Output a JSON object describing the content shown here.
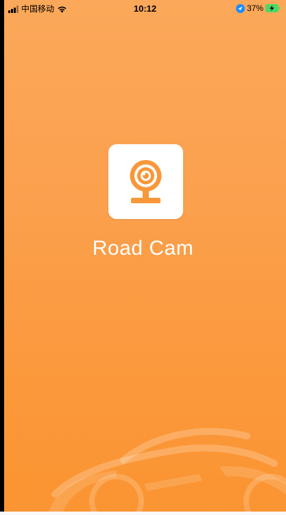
{
  "status_bar": {
    "carrier": "中国移动",
    "time": "10:12",
    "battery": "37%",
    "icons": [
      "signal-icon",
      "wifi-icon",
      "location-icon",
      "battery-charging-icon"
    ]
  },
  "splash": {
    "app_name": "Road Cam",
    "logo_icon": "webcam-icon",
    "watermark": "car-silhouette"
  },
  "colors": {
    "background_top": "#fba85a",
    "background_bottom": "#fb9431",
    "accent": "#f8983a",
    "icon_bg": "#ffffff",
    "battery_green": "#4cd964",
    "location_blue": "#1a8cff"
  }
}
